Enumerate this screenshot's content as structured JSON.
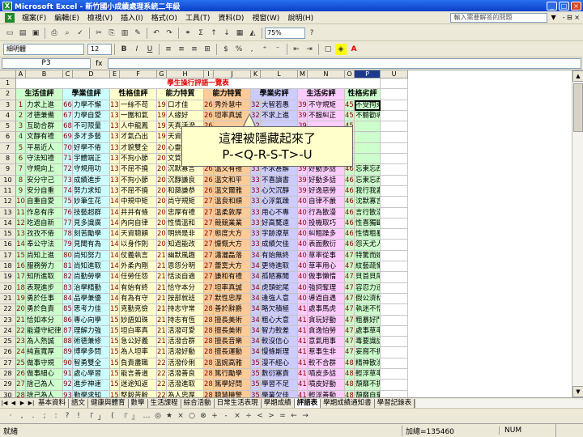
{
  "window": {
    "title": "Microsoft Excel - 新竹國小成績處理系統二年級"
  },
  "menu": {
    "items": [
      "檔案(F)",
      "編輯(E)",
      "檢視(V)",
      "插入(I)",
      "格式(O)",
      "工具(T)",
      "資料(D)",
      "視窗(W)",
      "說明(H)"
    ],
    "help_placeholder": "輸入需要解答的問題",
    "help_arrow": "▼",
    "close_doc": "- ⊟ ×"
  },
  "toolbar": {
    "zoom": "75%",
    "font": "細明體",
    "size": "12",
    "bold": "B",
    "italic": "I",
    "underline": "U",
    "sigma": "Σ",
    "fontcolor": "A"
  },
  "formula_bar": {
    "name_box": "P3",
    "fx": "fx",
    "value": ""
  },
  "grid": {
    "columns": [
      "A",
      "B",
      "C",
      "D",
      "E",
      "F",
      "G",
      "H",
      "I",
      "J",
      "K",
      "L",
      "M",
      "N",
      "O",
      "P",
      "U"
    ],
    "selected_column": "P",
    "sheet_title": "學生操行評語一覽表",
    "headers": [
      "生活佳評",
      "學業佳評",
      "性格佳評",
      "能力特質",
      "能力特質",
      "學業劣評",
      "生活劣評",
      "性格劣評"
    ],
    "rows": [
      [
        "1",
        "力求上進",
        "66",
        "力學不懈",
        "131",
        "一絲不苟",
        "196",
        "口才佳",
        "261",
        "秀外慧中",
        "326",
        "大智若愚",
        "391",
        "不守規矩",
        "456",
        "不受拘束"
      ],
      [
        "2",
        "才德兼備",
        "67",
        "力學自愛",
        "132",
        "一團和氣",
        "197",
        "人緣好",
        "262",
        "坦率真誠",
        "327",
        "不求上進",
        "392",
        "不服糾正",
        "457",
        "不聽勸導"
      ],
      [
        "3",
        "互助合群",
        "68",
        "不可限量",
        "133",
        "人中龍鳳",
        "198",
        "天真活潑",
        "263",
        "",
        "328",
        "",
        "393",
        "",
        "458",
        ""
      ],
      [
        "4",
        "文靜有禮",
        "69",
        "多才多藝",
        "134",
        "才氣凸出",
        "199",
        "天資聰穎",
        "264",
        "",
        "329",
        "",
        "394",
        "",
        "459",
        ""
      ],
      [
        "5",
        "平易近人",
        "70",
        "好學不倦",
        "135",
        "才貌雙全",
        "200",
        "心靈手巧",
        "265",
        "",
        "330",
        "",
        "395",
        "",
        "460",
        ""
      ],
      [
        "6",
        "守法知禮",
        "71",
        "宇體端正",
        "136",
        "不拘小節",
        "201",
        "文質彬彬",
        "266",
        "",
        "331",
        "",
        "396",
        "",
        "461",
        ""
      ],
      [
        "7",
        "守規向上",
        "72",
        "守規用功",
        "137",
        "不屈不撓",
        "202",
        "沉默寡言",
        "267",
        "溫文有禮",
        "332",
        "不求甚解",
        "397",
        "好動多話",
        "462",
        "忘東忘西"
      ],
      [
        "8",
        "安分守己",
        "73",
        "成績進步",
        "138",
        "不拘小節",
        "203",
        "沉靜謙良",
        "268",
        "溫文和平",
        "333",
        "不喜讀書",
        "398",
        "好動多話",
        "463",
        "忘東忘西"
      ],
      [
        "9",
        "安分自重",
        "74",
        "努力求知",
        "139",
        "不屈不撓",
        "204",
        "和藹謙恭",
        "269",
        "溫文爾雅",
        "334",
        "心欠沉靜",
        "399",
        "好逸惡勞",
        "464",
        "我行我素"
      ],
      [
        "10",
        "自重自愛",
        "75",
        "妙筆生花",
        "140",
        "中規中矩",
        "205",
        "尚守規矩",
        "270",
        "溫良和順",
        "335",
        "心浮氣躁",
        "400",
        "自律不嚴",
        "465",
        "沈默寡言"
      ],
      [
        "11",
        "作息有序",
        "76",
        "技藝超群",
        "141",
        "井井有條",
        "206",
        "忠厚有禮",
        "271",
        "溫柔敦厚",
        "336",
        "用心不專",
        "401",
        "行為散漫",
        "466",
        "言行散漫"
      ],
      [
        "12",
        "吃過自新",
        "77",
        "見多識廣",
        "142",
        "內向自律",
        "207",
        "性情溫和",
        "272",
        "競競業業",
        "337",
        "好高騖遠",
        "402",
        "投機取巧",
        "467",
        "性喜獨斷"
      ],
      [
        "13",
        "孜孜不倦",
        "78",
        "刻苦勵學",
        "143",
        "天資聰穎",
        "208",
        "明辨是非",
        "273",
        "態度大方",
        "338",
        "字跡潦草",
        "403",
        "糾粗躁多",
        "468",
        "性情粗暴"
      ],
      [
        "14",
        "奉公守法",
        "79",
        "見聞有為",
        "144",
        "以身作則",
        "209",
        "知過能改",
        "274",
        "慷慨大方",
        "339",
        "成績欠佳",
        "404",
        "表面敷衍",
        "469",
        "怨天尤人"
      ],
      [
        "15",
        "尚知上進",
        "80",
        "尚知努力",
        "145",
        "仗義執言",
        "210",
        "幽默風趣",
        "275",
        "瀟灑磊落",
        "340",
        "有始無終",
        "405",
        "草率從事",
        "470",
        "特驚而嬌"
      ],
      [
        "16",
        "服務勞力",
        "81",
        "尚知進取",
        "146",
        "外柔內剛",
        "211",
        "恩怨分明",
        "276",
        "蕾寞大方",
        "341",
        "更待進取",
        "406",
        "草率用心",
        "471",
        "紋藝疏懶"
      ],
      [
        "17",
        "知所進取",
        "82",
        "尚勤勞學",
        "147",
        "任勞任怨",
        "212",
        "恬淡自適",
        "277",
        "謙和有禮",
        "342",
        "孤陋寡聞",
        "407",
        "做事懶惰",
        "472",
        "貝首貝尾"
      ],
      [
        "18",
        "表現進步",
        "83",
        "治學精勤",
        "148",
        "有始有終",
        "213",
        "恰守本分",
        "278",
        "坦率真誠",
        "343",
        "虎頭蛇尾",
        "408",
        "強詞奪理",
        "473",
        "容忍力迅"
      ],
      [
        "19",
        "勇於任事",
        "84",
        "品學兼優",
        "149",
        "有為有守",
        "214",
        "按部就班",
        "279",
        "默性忠厚",
        "344",
        "逢強人意",
        "409",
        "導過自遇",
        "474",
        "假公濟私"
      ],
      [
        "20",
        "勇於負責",
        "85",
        "思考力佳",
        "150",
        "克勤克儉",
        "215",
        "持志守常",
        "280",
        "善於辭爵",
        "345",
        "略欠積極",
        "410",
        "處事馬虎",
        "475",
        "執迷不悟"
      ],
      [
        "21",
        "恰如本分",
        "86",
        "專心向學",
        "151",
        "妙語如珠",
        "216",
        "持志有恆",
        "281",
        "擅長美術",
        "346",
        "粗心大意",
        "411",
        "貪玩好動",
        "476",
        "粗暴好鬥"
      ],
      [
        "22",
        "能遵守紀律",
        "87",
        "理解力強",
        "152",
        "坦白率真",
        "217",
        "活潑可愛",
        "282",
        "擅長美術",
        "347",
        "智力較差",
        "412",
        "貪逸怕勞",
        "477",
        "處事草率"
      ],
      [
        "23",
        "為人熱誠",
        "88",
        "術德兼修",
        "153",
        "急公好義",
        "218",
        "活潑合群",
        "283",
        "擅長音樂",
        "348",
        "較沒信心",
        "413",
        "意氣用事",
        "478",
        "毒要識話"
      ],
      [
        "24",
        "純直寬厚",
        "89",
        "博學多問",
        "154",
        "為人坦率",
        "219",
        "活潑好動",
        "284",
        "擅長運動",
        "349",
        "慢條斯理",
        "414",
        "惹事生非",
        "479",
        "妄窩不振"
      ],
      [
        "25",
        "做事守規",
        "90",
        "智勇雙全",
        "155",
        "負責盡職",
        "220",
        "活潑伶俐",
        "285",
        "溫婉高雅",
        "350",
        "漫不經心",
        "415",
        "較不合群",
        "480",
        "精神散渙"
      ],
      [
        "26",
        "做事細心",
        "91",
        "處心學習",
        "156",
        "能言善道",
        "221",
        "活潑善良",
        "286",
        "篤行勵學",
        "351",
        "數衍塞責",
        "416",
        "噴皮多話",
        "481",
        "輕浮草率"
      ],
      [
        "27",
        "捨己為人",
        "92",
        "進步神速",
        "157",
        "迷途知返",
        "222",
        "活潑進取",
        "287",
        "篤學好問",
        "352",
        "學習不足",
        "417",
        "噴皮好動",
        "482",
        "頹靡不振"
      ],
      [
        "28",
        "捨己為人",
        "93",
        "勤學求知",
        "158",
        "堅毅苦幹",
        "223",
        "為人忠厚",
        "288",
        "聰慧機警",
        "353",
        "學業欠佳",
        "418",
        "輕浮善動",
        "483",
        "頹靡自棄"
      ],
      [
        "29",
        "貴在心胸",
        "94",
        "勤勉不懈",
        "159",
        "成事數歧",
        "224",
        "個性平和",
        "289",
        "慧悟伶俐",
        "354",
        "學業平平",
        "419",
        "衝動好鬥",
        "484",
        "處事草率"
      ],
      [
        "30",
        "貴在心胸",
        "95",
        "勤奮學向",
        "160",
        "得失懷遠",
        "225",
        "個性溫和",
        "290",
        "聰穎伶俐",
        "355",
        "表情待誌",
        "420",
        "衝動無知",
        "485",
        "處事草率"
      ]
    ]
  },
  "callout": {
    "line1": "這裡被隱藏起來了",
    "line2": "P-<Q-R-S-T>-U"
  },
  "sheet_tabs": [
    "基本資料",
    "語文",
    "健康與體育",
    "數學",
    "生活課程",
    "綜合活動",
    "日常生活表現",
    "學期成績",
    "評語表",
    "學期成績通知書",
    "學習記錄表"
  ],
  "active_tab": "評語表",
  "status": {
    "ready": "就緒",
    "sum": "加總=135460",
    "num": "NUM"
  }
}
